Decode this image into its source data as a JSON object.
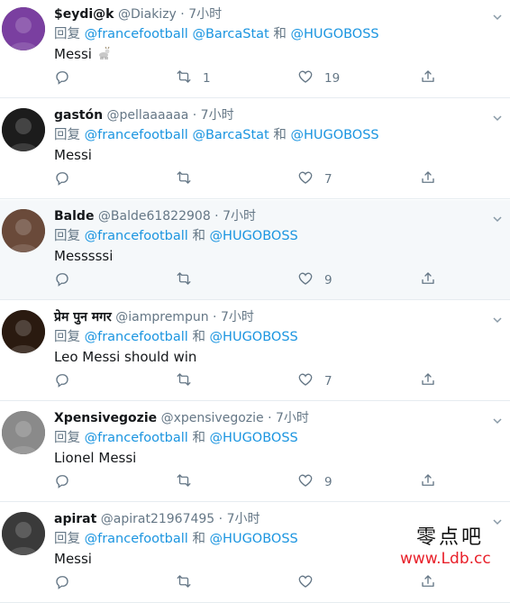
{
  "reply_prefix": "回复",
  "and_word": "和",
  "tweets": [
    {
      "name": "$eydi@k",
      "handle": "@Diakizy",
      "time": "7小时",
      "mentions": [
        "@francefootball",
        "@BarcaStat",
        "@HUGOBOSS"
      ],
      "text": "Messi",
      "emoji": "goat",
      "retweets": "1",
      "likes": "19",
      "avatar_color": "#7a3fa0"
    },
    {
      "name": "gastón",
      "handle": "@pellaaaaaa",
      "time": "7小时",
      "mentions": [
        "@francefootball",
        "@BarcaStat",
        "@HUGOBOSS"
      ],
      "text": "Messi",
      "retweets": "",
      "likes": "7",
      "avatar_color": "#1c1c1c"
    },
    {
      "name": "Balde",
      "handle": "@Balde61822908",
      "time": "7小时",
      "mentions": [
        "@francefootball",
        "@HUGOBOSS"
      ],
      "text": "Messsssi",
      "retweets": "",
      "likes": "9",
      "avatar_color": "#6a4a3a"
    },
    {
      "name": "प्रेम पुन मगर",
      "handle": "@iamprempun",
      "time": "7小时",
      "mentions": [
        "@francefootball",
        "@HUGOBOSS"
      ],
      "text": "Leo Messi should win",
      "retweets": "",
      "likes": "7",
      "avatar_color": "#2a1a10"
    },
    {
      "name": "Xpensivegozie",
      "handle": "@xpensivegozie",
      "time": "7小时",
      "mentions": [
        "@francefootball",
        "@HUGOBOSS"
      ],
      "text": "Lionel Messi",
      "retweets": "",
      "likes": "9",
      "avatar_color": "#8a8a8a"
    },
    {
      "name": "apirat",
      "handle": "@apirat21967495",
      "time": "7小时",
      "mentions": [
        "@francefootball",
        "@HUGOBOSS"
      ],
      "text": "Messi",
      "retweets": "",
      "likes": "",
      "avatar_color": "#3a3a3a"
    }
  ],
  "watermark": {
    "line1": "零点吧",
    "line2": "www.Ldb.cc"
  },
  "colors": {
    "link": "#1b95e0",
    "muted": "#657786",
    "highlight_row": "#f5f8fa",
    "watermark_red": "#e8202a"
  }
}
